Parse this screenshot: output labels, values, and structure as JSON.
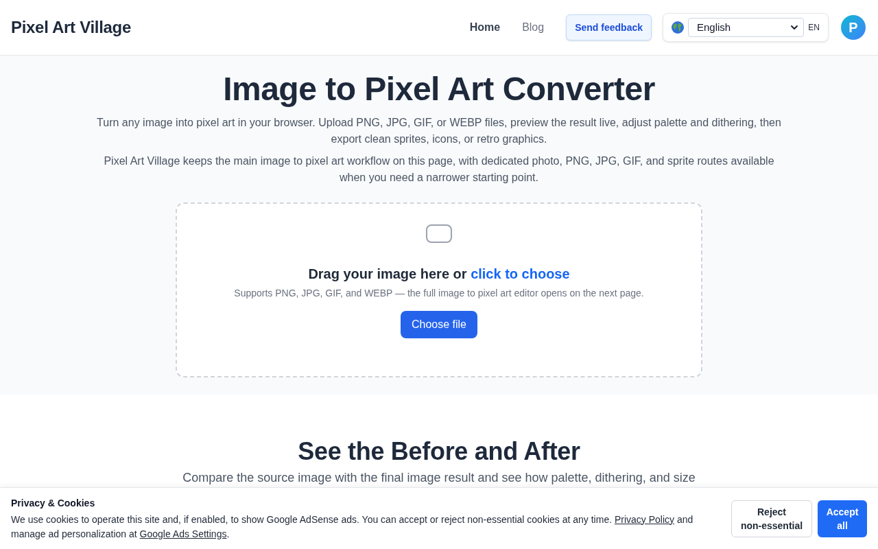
{
  "header": {
    "logo": "Pixel Art Village",
    "nav": [
      {
        "label": "Home",
        "selected": true
      },
      {
        "label": "Blog",
        "selected": false
      }
    ],
    "feedback_button": "Send feedback",
    "language": {
      "value": "English",
      "code": "EN"
    },
    "avatar_initial": "P"
  },
  "hero": {
    "title": "Image to Pixel Art Converter",
    "paragraphs": [
      "Turn any image into pixel art in your browser. Upload PNG, JPG, GIF, or WEBP files, preview the result live, adjust palette and dithering, then export clean sprites, icons, or retro graphics.",
      "Pixel Art Village keeps the main image to pixel art workflow on this page, with dedicated photo, PNG, JPG, GIF, and sprite routes available when you need a narrower starting point."
    ],
    "dropzone": {
      "prompt": "Drag your image here or ",
      "link": "click to choose",
      "hint": "Supports PNG, JPG, GIF, and WEBP — the full image to pixel art editor opens on the next page.",
      "button": "Choose file"
    }
  },
  "comparison": {
    "title": "See the Before and After",
    "intro": "Compare the source image with the final image result and see how palette, dithering, and size"
  },
  "cookie_banner": {
    "title": "Privacy & Cookies",
    "text_parts": [
      {
        "kind": "text",
        "text": "We use cookies to operate this site and, if enabled, to show Google AdSense ads. You can accept or reject non-essential cookies at any time. "
      },
      {
        "kind": "link",
        "text": "Privacy Policy"
      },
      {
        "kind": "text",
        "text": " and manage ad personalization at "
      },
      {
        "kind": "link",
        "text": "Google Ads Settings"
      },
      {
        "kind": "text",
        "text": "."
      }
    ],
    "buttons": [
      {
        "label": "Reject non-essential",
        "kind": "secondary"
      },
      {
        "label": "Accept all",
        "kind": "primary"
      }
    ]
  }
}
